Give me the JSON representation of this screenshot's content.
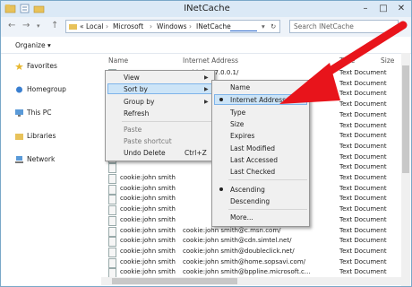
{
  "window": {
    "title": "INetCache",
    "minimize": "–",
    "maximize": "□",
    "close": "✕"
  },
  "address": {
    "crumbs": [
      "« Local",
      "Microsoft",
      "Windows",
      "INetCache"
    ],
    "search_placeholder": "Search INetCache"
  },
  "toolbar": {
    "organize": "Organize ▾"
  },
  "sidebar": {
    "items": [
      {
        "label": "Favorites",
        "icon": "star-icon"
      },
      {
        "label": "Homegroup",
        "icon": "homegroup-icon"
      },
      {
        "label": "This PC",
        "icon": "computer-icon"
      },
      {
        "label": "Libraries",
        "icon": "library-icon"
      },
      {
        "label": "Network",
        "icon": "network-icon"
      }
    ]
  },
  "columns": {
    "name": "Name",
    "address": "Internet Address",
    "type": "Type",
    "size": "Size"
  },
  "rows": [
    {
      "name": "",
      "address": "smith@127.0.0.1/",
      "type": "Text Document"
    },
    {
      "name": "",
      "address": "",
      "type": "Text Document"
    },
    {
      "name": "",
      "address": "",
      "type": "Text Document"
    },
    {
      "name": "",
      "address": "",
      "type": "Text Document"
    },
    {
      "name": "",
      "address": "",
      "type": "Text Document"
    },
    {
      "name": "",
      "address": "",
      "type": "Text Document"
    },
    {
      "name": "",
      "address": "",
      "type": "Text Document"
    },
    {
      "name": "",
      "address": "",
      "type": "Text Document"
    },
    {
      "name": "",
      "address": "",
      "type": "Text Document"
    },
    {
      "name": "",
      "address": "",
      "type": "Text Document"
    },
    {
      "name": "cookie:john smith",
      "address": "",
      "type": "Text Document"
    },
    {
      "name": "cookie:john smith",
      "address": "",
      "type": "Text Document"
    },
    {
      "name": "cookie:john smith",
      "address": "",
      "type": "Text Document"
    },
    {
      "name": "cookie:john smith",
      "address": "",
      "type": "Text Document"
    },
    {
      "name": "cookie:john smith",
      "address": "",
      "type": "Text Document"
    },
    {
      "name": "cookie:john smith",
      "address": "cookie:john smith@c.msn.com/",
      "type": "Text Document"
    },
    {
      "name": "cookie:john smith",
      "address": "cookie:john smith@cdn.simtel.net/",
      "type": "Text Document"
    },
    {
      "name": "cookie:john smith",
      "address": "cookie:john smith@doubleclick.net/",
      "type": "Text Document"
    },
    {
      "name": "cookie:john smith",
      "address": "cookie:john smith@home.sopsavi.com/",
      "type": "Text Document"
    },
    {
      "name": "cookie:john smith",
      "address": "cookie:john smith@bppline.microsoft.c...",
      "type": "Text Document"
    }
  ],
  "context_menu": {
    "items": [
      "View",
      "Sort by",
      "Group by",
      "Refresh",
      "Paste",
      "Paste shortcut",
      "Undo Delete"
    ],
    "undo_shortcut": "Ctrl+Z"
  },
  "sort_menu": {
    "items": [
      "Name",
      "Internet Address",
      "Type",
      "Size",
      "Expires",
      "Last Modified",
      "Last Accessed",
      "Last Checked",
      "Ascending",
      "Descending",
      "More..."
    ]
  },
  "annotation": {
    "arrow_color": "#e8141b"
  }
}
